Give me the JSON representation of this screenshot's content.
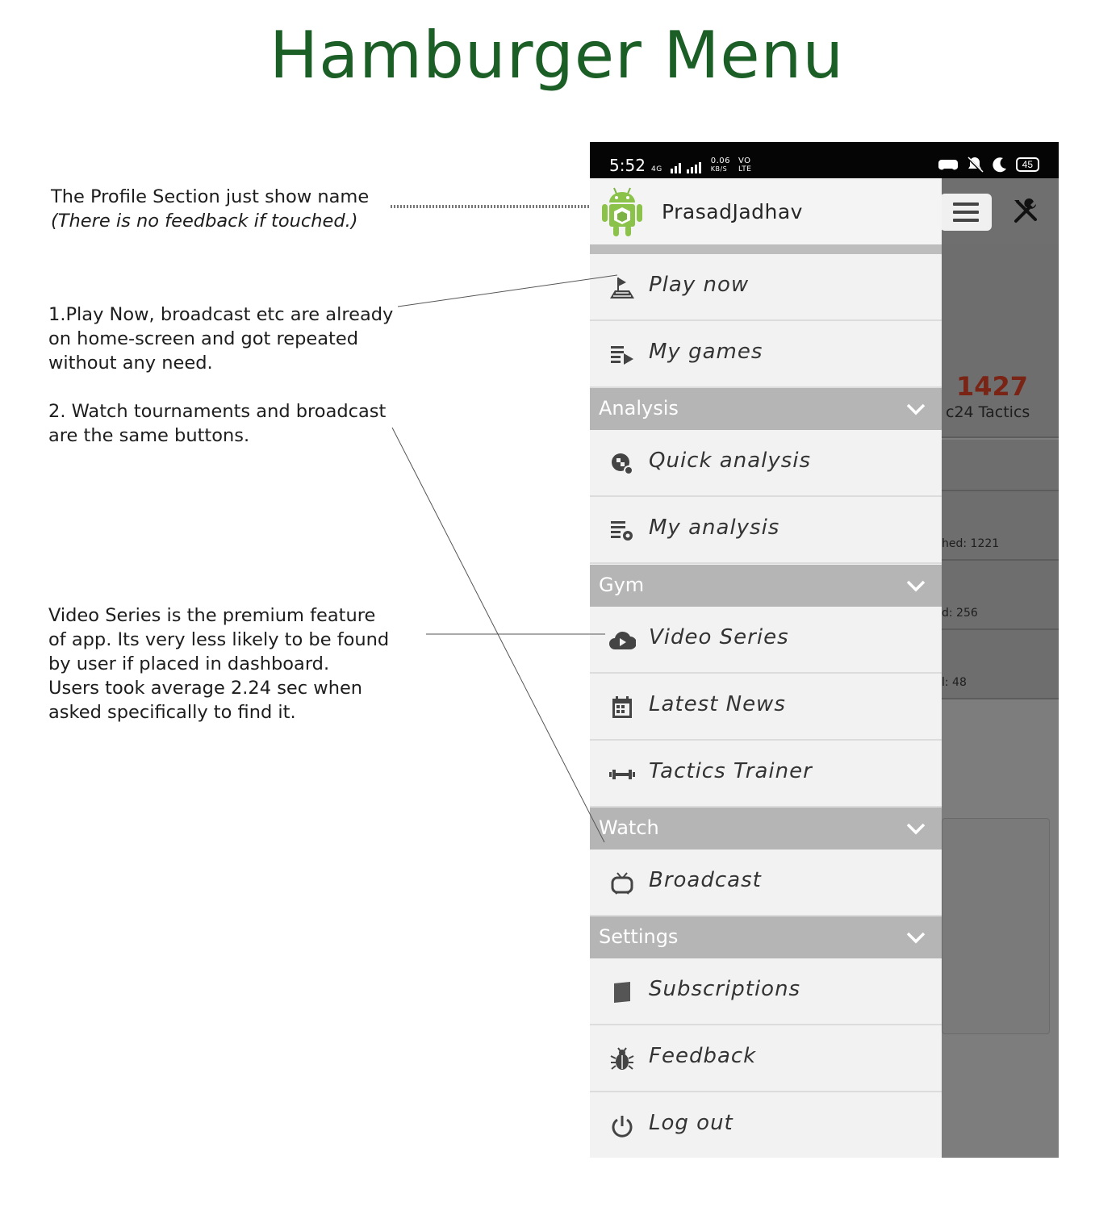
{
  "title": "Hamburger Menu",
  "notes": {
    "profile": {
      "line1": "The Profile Section just show name",
      "line2": "(There is no feedback if touched.)"
    },
    "repeat": {
      "lines": [
        "1.Play Now, broadcast etc are already",
        "on home-screen and got repeated",
        "without any need."
      ],
      "lines2": [
        "2. Watch tournaments and broadcast",
        "are the same buttons."
      ]
    },
    "video": {
      "lines": [
        "Video Series is the premium feature",
        "of app. Its very less likely to be found",
        "by user if placed in dashboard.",
        "Users took average 2.24 sec when",
        "asked specifically to find it."
      ]
    }
  },
  "status_bar": {
    "time": "5:52",
    "net_speed_top": "0.06",
    "net_speed_bottom": "KB/S",
    "net_type": "4G",
    "volte_top": "VO",
    "volte_bottom": "LTE",
    "battery": "45"
  },
  "profile": {
    "name": "PrasadJadhav",
    "avatar_icon": "android-icon"
  },
  "background_app": {
    "rating": "1427",
    "rating_label": "c24 Tactics",
    "stats": [
      "hed: 1221",
      "d: 256",
      "l: 48"
    ]
  },
  "menu": {
    "play_now": "Play now",
    "my_games": "My games",
    "analysis_header": "Analysis",
    "quick_analysis": "Quick analysis",
    "my_analysis": "My analysis",
    "gym_header": "Gym",
    "video_series": "Video Series",
    "latest_news": "Latest News",
    "tactics_trainer": "Tactics Trainer",
    "watch_header": "Watch",
    "broadcast": "Broadcast",
    "settings_header": "Settings",
    "subscriptions": "Subscriptions",
    "feedback": "Feedback",
    "log_out": "Log out"
  },
  "colors": {
    "title": "#1b5e26",
    "section_header": "#b5b5b5",
    "rating": "#7a2415"
  }
}
